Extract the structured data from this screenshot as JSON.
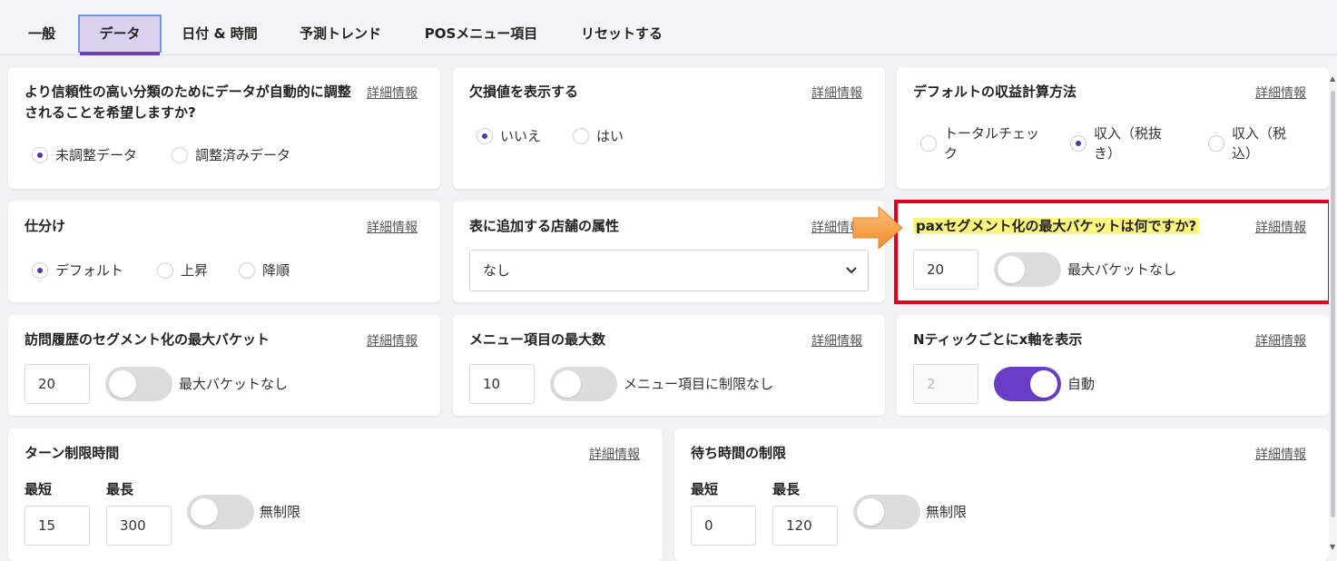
{
  "tabs": [
    "一般",
    "データ",
    "日付 & 時間",
    "予測トレンド",
    "POSメニュー項目",
    "リセットする"
  ],
  "info_link": "詳細情報",
  "cards": {
    "adjust": {
      "title": "より信頼性の高い分類のためにデータが自動的に調整されることを希望しますか?",
      "options": [
        "未調整データ",
        "調整済みデータ"
      ],
      "selected": "未調整データ"
    },
    "missing": {
      "title": "欠損値を表示する",
      "options": [
        "いいえ",
        "はい"
      ],
      "selected": "いいえ"
    },
    "revenue": {
      "title": "デフォルトの収益計算方法",
      "options": [
        "トータルチェック",
        "収入（税抜き）",
        "収入（税込）"
      ],
      "selected": "収入（税抜き）"
    },
    "sort": {
      "title": "仕分け",
      "options": [
        "デフォルト",
        "上昇",
        "降順"
      ],
      "selected": "デフォルト"
    },
    "store_attr": {
      "title": "表に追加する店舗の属性",
      "select_value": "なし"
    },
    "pax": {
      "title": "paxセグメント化の最大バケットは何ですか?",
      "value": "20",
      "toggle_label": "最大バケットなし",
      "toggle_on": false
    },
    "visit_history": {
      "title": "訪問履歴のセグメント化の最大バケット",
      "value": "20",
      "toggle_label": "最大バケットなし",
      "toggle_on": false
    },
    "menu_max": {
      "title": "メニュー項目の最大数",
      "value": "10",
      "toggle_label": "メニュー項目に制限なし",
      "toggle_on": false
    },
    "xaxis": {
      "title": "Nティックごとにx軸を表示",
      "value": "2",
      "toggle_label": "自動",
      "toggle_on": true
    },
    "turn_time": {
      "title": "ターン制限時間",
      "min_label": "最短",
      "max_label": "最長",
      "min_value": "15",
      "max_value": "300",
      "toggle_label": "無制限",
      "toggle_on": false
    },
    "wait_time": {
      "title": "待ち時間の制限",
      "min_label": "最短",
      "max_label": "最長",
      "min_value": "0",
      "max_value": "120",
      "toggle_label": "無制限",
      "toggle_on": false
    }
  },
  "colors": {
    "accent": "#6a3dc8",
    "highlight_border": "#e3001b",
    "highlight_bg": "#fbf77e",
    "arrow": "#f7a34a"
  }
}
